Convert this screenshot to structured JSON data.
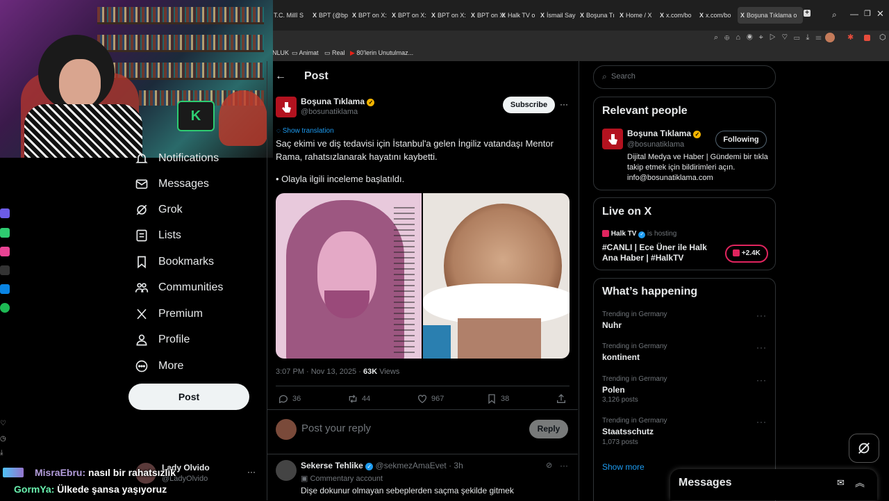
{
  "browser": {
    "tabs": [
      "T.C. Millî S",
      "BPT (@bp",
      "BPT on X:",
      "BPT on X:",
      "BPT on X:",
      "BPT on X:",
      "Halk TV o",
      "İsmail Say",
      "Boşuna Tı",
      "Home / X",
      "x.com/bo",
      "x.com/bo",
      "Boşuna Tıklama o"
    ],
    "bookmarks": [
      "NLUK",
      "Animat",
      "Real",
      "80'lerin Unutulmaz..."
    ]
  },
  "sidebar": {
    "items": [
      {
        "label": "Notifications",
        "icon": "bell-icon"
      },
      {
        "label": "Messages",
        "icon": "mail-icon"
      },
      {
        "label": "Grok",
        "icon": "grok-icon"
      },
      {
        "label": "Lists",
        "icon": "list-icon"
      },
      {
        "label": "Bookmarks",
        "icon": "bookmark-icon"
      },
      {
        "label": "Communities",
        "icon": "people-icon"
      },
      {
        "label": "Premium",
        "icon": "x-logo-icon"
      },
      {
        "label": "Profile",
        "icon": "person-icon"
      },
      {
        "label": "More",
        "icon": "more-circle-icon"
      }
    ],
    "post_label": "Post",
    "account": {
      "name": "Lady Olvido",
      "handle": "@LadyOlvido"
    }
  },
  "header": {
    "title": "Post"
  },
  "tweet": {
    "author": "Boşuna Tıklama",
    "handle": "@bosunatiklama",
    "subscribe": "Subscribe",
    "show_translation": "Show translation",
    "text1": "Saç ekimi ve diş tedavisi için İstanbul'a gelen İngiliz vatandaşı Mentor Rama, rahatsızlanarak hayatını kaybetti.",
    "text2": "• Olayla ilgili inceleme başlatıldı.",
    "time": "3:07 PM · Nov 13, 2025 · ",
    "views_count": "63K",
    "views_label": " Views",
    "replies": "36",
    "reposts": "44",
    "likes": "967",
    "bookmarks": "38"
  },
  "reply_box": {
    "placeholder": "Post your reply",
    "button": "Reply"
  },
  "reply": {
    "author": "Sekerse Tehlike",
    "handle": "@sekmezAmaEvet · 3h",
    "badge": "Commentary account",
    "text": "Dişe dokunur olmayan sebeplerden saçma şekilde gitmek"
  },
  "search": {
    "placeholder": "Search"
  },
  "relevant": {
    "title": "Relevant people",
    "name": "Boşuna Tıklama",
    "handle": "@bosunatiklama",
    "following": "Following",
    "bio": "Dijital Medya ve Haber | Gündemi bir tıkla takip etmek için bildirimleri açın. info@bosunatiklama.com"
  },
  "live": {
    "title": "Live on X",
    "host": "Halk TV",
    "hosting": "is hosting",
    "text": "#CANLI | Ece Üner ile Halk Ana Haber | #HalkTV",
    "count": "+2.4K"
  },
  "happening": {
    "title": "What’s happening",
    "trends": [
      {
        "cat": "Trending in Germany",
        "name": "Nuhr",
        "posts": ""
      },
      {
        "cat": "Trending in Germany",
        "name": "kontinent",
        "posts": ""
      },
      {
        "cat": "Trending in Germany",
        "name": "Polen",
        "posts": "3,126 posts"
      },
      {
        "cat": "Trending in Germany",
        "name": "Staatsschutz",
        "posts": "1,073 posts"
      }
    ],
    "show_more": "Show more"
  },
  "messages_drawer": {
    "title": "Messages"
  },
  "chat": [
    {
      "user": "MisraEbru:",
      "msg": " nasıl bir rahatsızlık",
      "color": "#b39ddb"
    },
    {
      "user": "GormYa:",
      "msg": " Ülkede şansa yaşıyoruz",
      "color": "#69f0ae"
    }
  ],
  "colors": {
    "accent": "#1d9bf0",
    "brand_red": "#b3121f",
    "background": "#000000"
  }
}
